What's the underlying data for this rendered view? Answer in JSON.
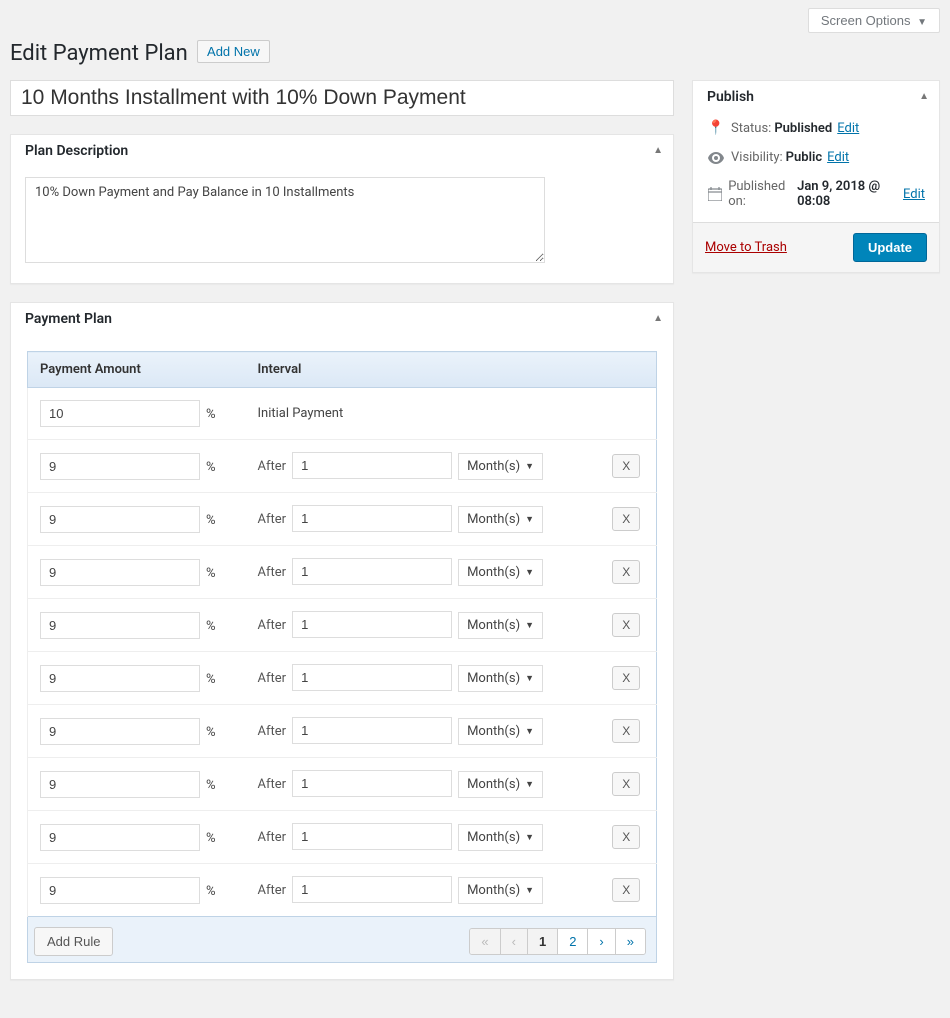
{
  "top": {
    "screen_options": "Screen Options",
    "page_title": "Edit Payment Plan",
    "add_new": "Add New"
  },
  "title_input": {
    "value": "10 Months Installment with 10% Down Payment"
  },
  "description_box": {
    "heading": "Plan Description",
    "value": "10% Down Payment and Pay Balance in 10 Installments"
  },
  "plan_box": {
    "heading": "Payment Plan",
    "columns": {
      "amount": "Payment Amount",
      "interval": "Interval"
    },
    "initial": {
      "amount": "10",
      "interval_label": "Initial Payment"
    },
    "pct_symbol": "%",
    "after_label": "After",
    "unit_label": "Month(s)",
    "remove_label": "X",
    "rows": [
      {
        "amount": "9",
        "interval": "1"
      },
      {
        "amount": "9",
        "interval": "1"
      },
      {
        "amount": "9",
        "interval": "1"
      },
      {
        "amount": "9",
        "interval": "1"
      },
      {
        "amount": "9",
        "interval": "1"
      },
      {
        "amount": "9",
        "interval": "1"
      },
      {
        "amount": "9",
        "interval": "1"
      },
      {
        "amount": "9",
        "interval": "1"
      },
      {
        "amount": "9",
        "interval": "1"
      }
    ],
    "footer": {
      "add_rule": "Add Rule",
      "pager": {
        "first": "«",
        "prev": "‹",
        "next": "›",
        "last": "»",
        "pages": [
          "1",
          "2"
        ],
        "active_index": 0
      }
    }
  },
  "publish_box": {
    "heading": "Publish",
    "status": {
      "label": "Status:",
      "value": "Published",
      "edit": "Edit"
    },
    "visibility": {
      "label": "Visibility:",
      "value": "Public",
      "edit": "Edit"
    },
    "published": {
      "label": "Published on:",
      "value": "Jan 9, 2018 @ 08:08",
      "edit": "Edit"
    },
    "trash": "Move to Trash",
    "update": "Update"
  }
}
